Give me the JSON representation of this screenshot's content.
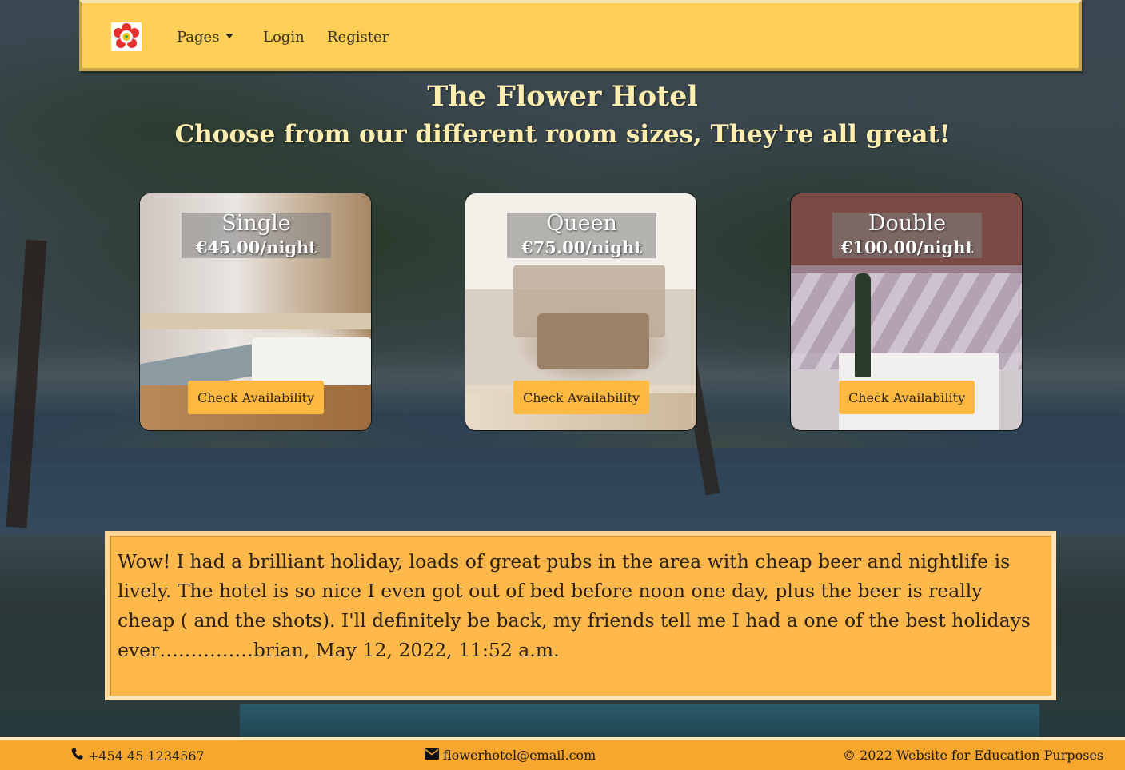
{
  "navbar": {
    "logo_alt": "flower-logo",
    "items": [
      {
        "label": "Pages",
        "dropdown": true
      },
      {
        "label": "Login"
      },
      {
        "label": "Register"
      }
    ]
  },
  "hero": {
    "title": "The Flower Hotel",
    "subtitle": "Choose from our different room sizes, They're all great!"
  },
  "rooms": [
    {
      "name": "Single",
      "price": "€45.00/night",
      "button": "Check Availability"
    },
    {
      "name": "Queen",
      "price": "€75.00/night",
      "button": "Check Availability"
    },
    {
      "name": "Double",
      "price": "€100.00/night",
      "button": "Check Availability"
    }
  ],
  "review": {
    "text": "Wow! I had a brilliant holiday, loads of great pubs in the area with cheap beer and nightlife is lively. The hotel is so nice I even got out of bed before noon one day, plus the beer is really cheap ( and the shots). I'll definitely be back, my friends tell me I had a one of the best holidays ever……………brian, May 12, 2022, 11:52 a.m."
  },
  "footer": {
    "phone": "+454 45 1234567",
    "email": "flowerhotel@email.com",
    "copyright": "© 2022 Website for Education Purposes",
    "phone_icon": "phone-icon",
    "email_icon": "envelope-icon"
  },
  "colors": {
    "navbar_bg": "#ffcf57",
    "button_bg": "#ffb840",
    "review_bg": "#ffb84a",
    "footer_bg": "#f7a72e",
    "heading_text": "#ffeeb0"
  }
}
